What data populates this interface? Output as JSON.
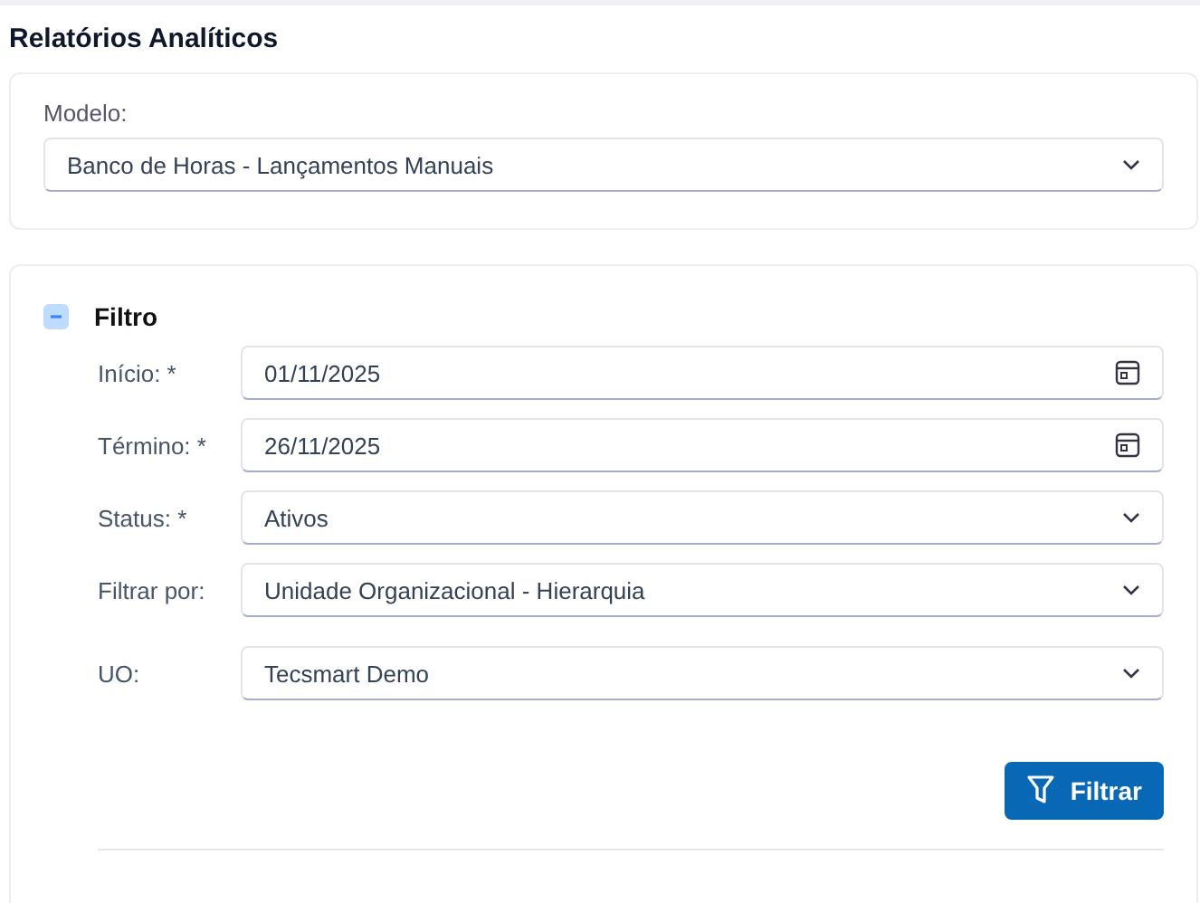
{
  "page_title": "Relatórios Analíticos",
  "model": {
    "label": "Modelo:",
    "value": "Banco de Horas - Lançamentos Manuais"
  },
  "filter": {
    "title": "Filtro",
    "expanded": true,
    "fields": [
      {
        "label": "Início: *",
        "value": "01/11/2025",
        "kind": "date"
      },
      {
        "label": "Término: *",
        "value": "26/11/2025",
        "kind": "date"
      },
      {
        "label": "Status: *",
        "value": "Ativos",
        "kind": "select"
      },
      {
        "label": "Filtrar por:",
        "value": "Unidade Organizacional - Hierarquia",
        "kind": "select"
      },
      {
        "label": "UO:",
        "value": "Tecsmart Demo",
        "kind": "select"
      }
    ],
    "button": "Filtrar"
  }
}
